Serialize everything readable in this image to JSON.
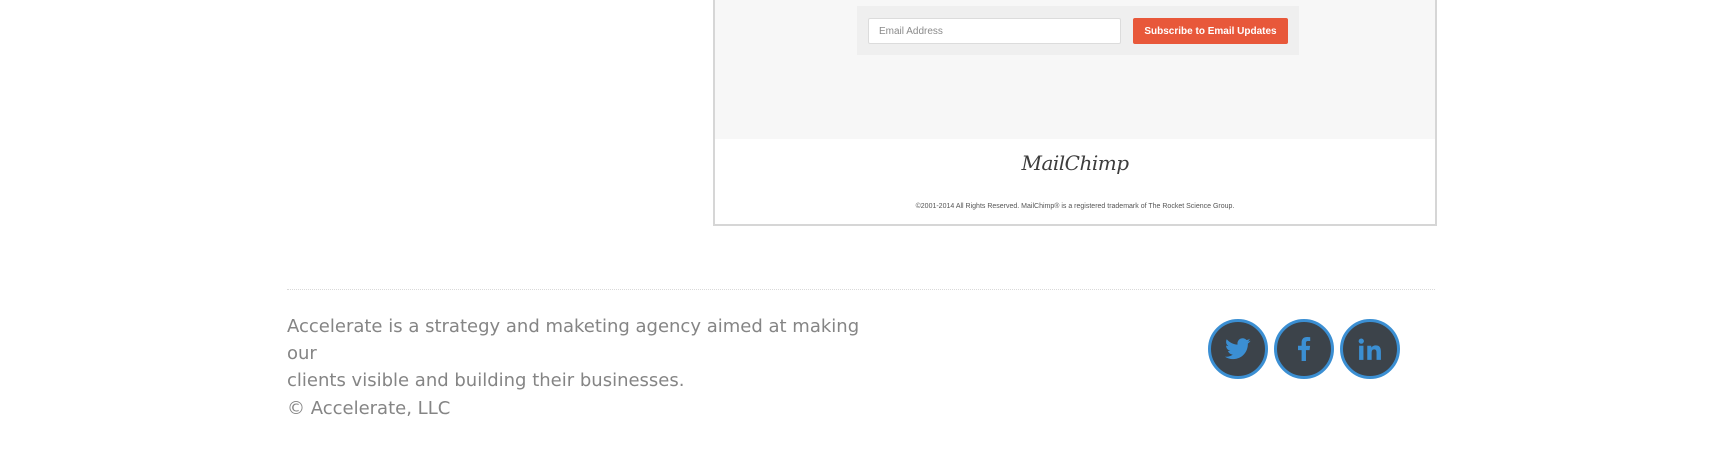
{
  "mailchimp_form": {
    "email_placeholder": "Email Address",
    "subscribe_label": "Subscribe to Email Updates",
    "logo_text": "MailChimp",
    "copyright_text": "©2001-2014 All Rights Reserved. MailChimp® is a registered trademark of The Rocket Science Group.",
    "button_color": "#e8583a"
  },
  "footer": {
    "about_line1": "Accelerate is a strategy and maketing agency aimed at making our",
    "about_line2": "clients visible and building their businesses.",
    "copyright": "© Accelerate, LLC",
    "social": [
      {
        "icon": "twitter-icon"
      },
      {
        "icon": "facebook-icon"
      },
      {
        "icon": "linkedin-icon"
      }
    ],
    "social_ring_color": "#3b8fd3",
    "social_bg_color": "#3c434a"
  }
}
